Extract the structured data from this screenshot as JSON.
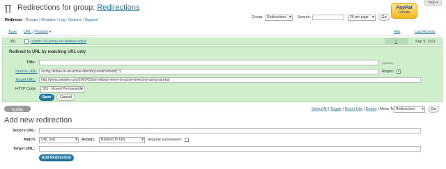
{
  "header": {
    "title_prefix": "Redirections for group: ",
    "title_link": "Redirections",
    "help_label": "Help ▾",
    "paypal": {
      "brand": "PayPal",
      "donate": "Donate"
    }
  },
  "nav": {
    "items": [
      "Redirects",
      "Groups",
      "Modules",
      "Log",
      "Options",
      "Support"
    ],
    "separator": " | "
  },
  "filter": {
    "group_label": "Group:",
    "group_value": "Redirections",
    "search_label": "Search:",
    "search_value": "",
    "per_page_value": "25 per page",
    "go_label": "Go"
  },
  "table": {
    "col_type": "Type",
    "col_url": "URL",
    "col_position": "Position",
    "col_hits": "Hits",
    "col_last_access": "Last Access",
    "row": {
      "type": "301",
      "url": "/zaptic-10-proxy-on-debian-sqlite",
      "hits": "2",
      "last_access": "Sep 9, 2011"
    }
  },
  "edit": {
    "heading": "Redirect to URL by matching URL only",
    "title_label": "Title:",
    "title_value": "",
    "optional_note": "(optional)",
    "source_label": "Source URL:",
    "source_value": "/using-debian-in-an-active-directory-environment(.*)",
    "regex_label": "Regex:",
    "target_label": "Target URL:",
    "target_value": "http://www.sunjake.com/2009/05/join-debian-lenny-to-active-directory-using-samba/",
    "http_label": "HTTP Code:",
    "http_value": "301 - Moved Permanently",
    "save_label": "Save",
    "cancel_label": "Cancel"
  },
  "bulk": {
    "tag_label": "re-order",
    "select_all": "Select All",
    "toggle": "Toggle",
    "reset_hits": "Reset Hits",
    "delete": "Delete",
    "move_to": "Move To:",
    "move_value": "Redirections",
    "go_label": "Go"
  },
  "add": {
    "heading": "Add new redirection",
    "source_label": "Source URL:",
    "source_value": "",
    "match_label": "Match:",
    "match_value": "URL only",
    "action_label": "Action:",
    "action_value": "Redirect to URL",
    "regex_label": "Regular expression:",
    "target_label": "Target URL:",
    "target_value": "",
    "button_label": "Add Redirection"
  }
}
